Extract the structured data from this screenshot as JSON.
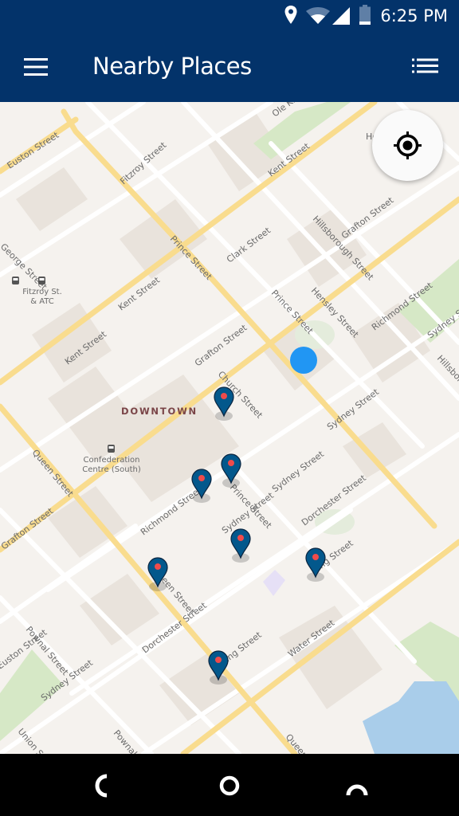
{
  "status_bar": {
    "time": "6:25 PM",
    "icons": [
      "location-icon",
      "wifi-icon",
      "cell-signal-icon",
      "battery-icon"
    ]
  },
  "app_bar": {
    "title": "Nearby Places",
    "left_icon": "menu-icon",
    "right_icon": "list-view-icon"
  },
  "map": {
    "district_label": "DOWNTOWN",
    "streets": [
      "Euston Street",
      "Fitzroy Street",
      "Kent Street",
      "Ole King",
      "Prince Street",
      "Clark Street",
      "Hillsborough Street",
      "Grafton Street",
      "Hensley Street",
      "Richmond Street",
      "Church Street",
      "Sydney Street",
      "Queen Street",
      "Dorchester Street",
      "King Street",
      "Water Street",
      "Pownal Street",
      "Union Street",
      "George Street"
    ],
    "pois": [
      {
        "name": "Fitzroy St. & ATC",
        "icon": "bus-stop-icon"
      },
      {
        "name": "Confederation Centre (South)",
        "icon": "bus-stop-icon"
      }
    ],
    "partial_label": "Ho",
    "markers": [
      {
        "id": 1,
        "icon": "place-marker-icon"
      },
      {
        "id": 2,
        "icon": "place-marker-icon"
      },
      {
        "id": 3,
        "icon": "place-marker-icon"
      },
      {
        "id": 4,
        "icon": "place-marker-icon"
      },
      {
        "id": 5,
        "icon": "place-marker-icon"
      },
      {
        "id": 6,
        "icon": "place-marker-icon"
      },
      {
        "id": 7,
        "icon": "place-marker-icon"
      }
    ],
    "current_location_icon": "current-location-dot",
    "locate_button_icon": "my-location-icon",
    "colors": {
      "marker_fill": "#03588c",
      "marker_dot": "#ef4b4b",
      "location_dot": "#2196f3",
      "major_road": "#f9dc8e",
      "park": "#d6e8c6",
      "water": "#a9cdea"
    }
  },
  "nav_bar": {
    "buttons": [
      "back-button",
      "home-button",
      "recents-button"
    ]
  }
}
